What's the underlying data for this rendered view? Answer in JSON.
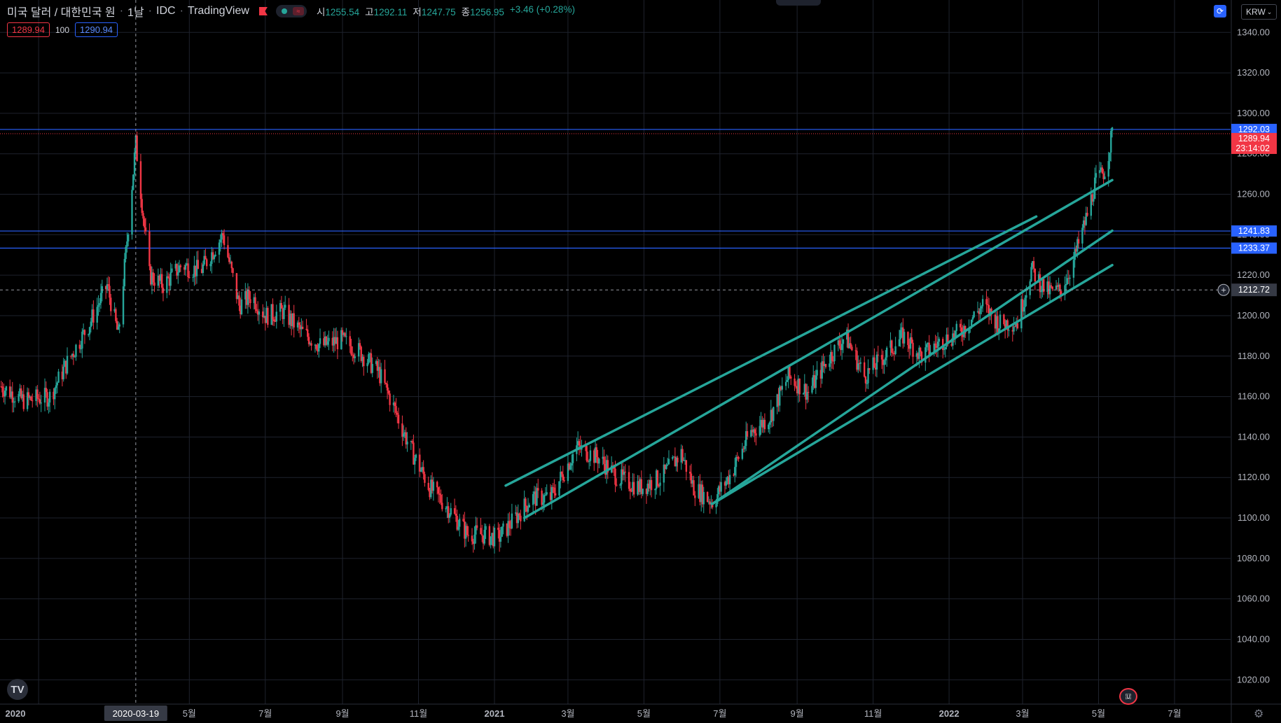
{
  "header": {
    "symbol_title": "미국 달러 / 대한민국 원",
    "interval": "1날",
    "source": "IDC",
    "provider": "TradingView",
    "ohlc": {
      "open_label": "시",
      "open": "1255.54",
      "high_label": "고",
      "high": "1292.11",
      "low_label": "저",
      "low": "1247.75",
      "close_label": "종",
      "close": "1256.95",
      "change": "+3.46 (+0.28%)"
    }
  },
  "order_boxes": {
    "sell": "1289.94",
    "qty": "100",
    "buy": "1290.94"
  },
  "currency_selector": "KRW",
  "colors": {
    "up": "#26a69a",
    "down": "#f23645",
    "channel": "#26a69a",
    "hline": "#2962ff",
    "bg": "#000000"
  },
  "icons": [
    "tradingview-logo-icon",
    "gear-icon",
    "flag-icon",
    "sync-icon",
    "plus-circle-icon"
  ],
  "chart_data": {
    "type": "candlestick",
    "title": "미국 달러 / 대한민국 원",
    "y_ticks": [
      "1340.00",
      "1320.00",
      "1300.00",
      "1280.00",
      "1260.00",
      "1240.00",
      "1220.00",
      "1200.00",
      "1180.00",
      "1160.00",
      "1140.00",
      "1120.00",
      "1100.00",
      "1080.00",
      "1060.00",
      "1040.00",
      "1020.00"
    ],
    "x_ticks": [
      {
        "label": "2020",
        "bold": true,
        "date": "2020-01-01"
      },
      {
        "label": "5월",
        "date": "2020-05-01"
      },
      {
        "label": "7월",
        "date": "2020-07-01"
      },
      {
        "label": "9월",
        "date": "2020-09-01"
      },
      {
        "label": "11월",
        "date": "2020-11-01"
      },
      {
        "label": "2021",
        "bold": true,
        "date": "2021-01-01"
      },
      {
        "label": "3월",
        "date": "2021-03-01"
      },
      {
        "label": "5월",
        "date": "2021-05-01"
      },
      {
        "label": "7월",
        "date": "2021-07-01"
      },
      {
        "label": "9월",
        "date": "2021-09-01"
      },
      {
        "label": "11월",
        "date": "2021-11-01"
      },
      {
        "label": "2022",
        "bold": true,
        "date": "2022-01-01"
      },
      {
        "label": "3월",
        "date": "2022-03-01"
      },
      {
        "label": "5월",
        "date": "2022-05-01"
      },
      {
        "label": "7월",
        "date": "2022-07-01"
      }
    ],
    "ylim": [
      1008,
      1356
    ],
    "xlim": [
      "2019-12-01",
      "2022-08-15"
    ],
    "grid": true,
    "crosshair": {
      "date_label": "2020-03-19",
      "date": "2020-03-19",
      "price": 1212.72,
      "price_label": "1212.72"
    },
    "horizontal_lines": [
      {
        "price": 1292.03,
        "label": "1292.03"
      },
      {
        "price": 1241.83,
        "label": "1241.83"
      },
      {
        "price": 1233.37,
        "label": "1233.37"
      }
    ],
    "last_price": {
      "price": 1289.94,
      "label": "1289.94",
      "countdown": "23:14:02"
    },
    "channel_lines": [
      {
        "x1": "2021-01-10",
        "y1": 1116,
        "x2": "2022-03-12",
        "y2": 1249
      },
      {
        "x1": "2021-01-25",
        "y1": 1100,
        "x2": "2022-05-12",
        "y2": 1267
      },
      {
        "x1": "2021-06-25",
        "y1": 1107,
        "x2": "2022-05-12",
        "y2": 1242
      },
      {
        "x1": "2021-06-25",
        "y1": 1107,
        "x2": "2022-05-12",
        "y2": 1225
      }
    ],
    "price_path": [
      [
        "2019-12-02",
        1165
      ],
      [
        "2019-12-20",
        1158
      ],
      [
        "2020-01-10",
        1160
      ],
      [
        "2020-01-25",
        1178
      ],
      [
        "2020-02-10",
        1195
      ],
      [
        "2020-02-25",
        1215
      ],
      [
        "2020-03-05",
        1190
      ],
      [
        "2020-03-19",
        1285
      ],
      [
        "2020-03-30",
        1220
      ],
      [
        "2020-04-10",
        1215
      ],
      [
        "2020-04-25",
        1225
      ],
      [
        "2020-05-10",
        1222
      ],
      [
        "2020-05-28",
        1240
      ],
      [
        "2020-06-10",
        1205
      ],
      [
        "2020-06-20",
        1210
      ],
      [
        "2020-07-01",
        1200
      ],
      [
        "2020-07-15",
        1202
      ],
      [
        "2020-07-30",
        1192
      ],
      [
        "2020-08-15",
        1185
      ],
      [
        "2020-08-31",
        1188
      ],
      [
        "2020-09-15",
        1182
      ],
      [
        "2020-09-30",
        1172
      ],
      [
        "2020-10-10",
        1158
      ],
      [
        "2020-10-25",
        1135
      ],
      [
        "2020-11-10",
        1115
      ],
      [
        "2020-11-25",
        1105
      ],
      [
        "2020-12-10",
        1092
      ],
      [
        "2020-12-20",
        1092
      ],
      [
        "2021-01-04",
        1090
      ],
      [
        "2021-01-15",
        1098
      ],
      [
        "2021-01-31",
        1110
      ],
      [
        "2021-02-15",
        1110
      ],
      [
        "2021-03-08",
        1135
      ],
      [
        "2021-03-25",
        1130
      ],
      [
        "2021-04-10",
        1120
      ],
      [
        "2021-04-28",
        1115
      ],
      [
        "2021-05-15",
        1120
      ],
      [
        "2021-05-31",
        1132
      ],
      [
        "2021-06-10",
        1115
      ],
      [
        "2021-06-25",
        1108
      ],
      [
        "2021-07-10",
        1122
      ],
      [
        "2021-07-25",
        1142
      ],
      [
        "2021-08-10",
        1150
      ],
      [
        "2021-08-25",
        1170
      ],
      [
        "2021-09-10",
        1162
      ],
      [
        "2021-09-25",
        1178
      ],
      [
        "2021-10-10",
        1190
      ],
      [
        "2021-10-25",
        1170
      ],
      [
        "2021-11-10",
        1180
      ],
      [
        "2021-11-25",
        1190
      ],
      [
        "2021-12-10",
        1180
      ],
      [
        "2021-12-25",
        1187
      ],
      [
        "2022-01-10",
        1192
      ],
      [
        "2022-01-28",
        1205
      ],
      [
        "2022-02-10",
        1196
      ],
      [
        "2022-02-25",
        1197
      ],
      [
        "2022-03-08",
        1223
      ],
      [
        "2022-03-20",
        1212
      ],
      [
        "2022-03-31",
        1212
      ],
      [
        "2022-04-10",
        1225
      ],
      [
        "2022-04-22",
        1250
      ],
      [
        "2022-04-28",
        1265
      ],
      [
        "2022-05-06",
        1272
      ],
      [
        "2022-05-12",
        1290
      ]
    ]
  }
}
